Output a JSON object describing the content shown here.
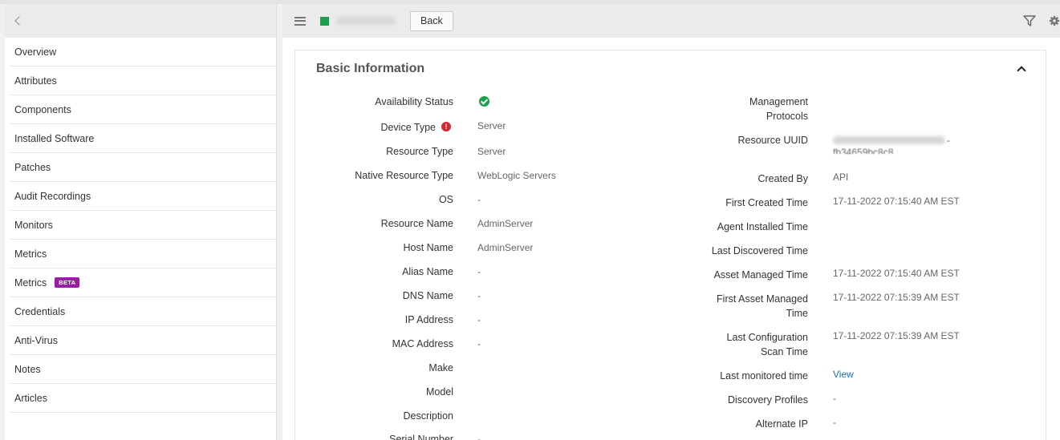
{
  "sidebar": {
    "items": [
      {
        "label": "Overview"
      },
      {
        "label": "Attributes"
      },
      {
        "label": "Components"
      },
      {
        "label": "Installed Software"
      },
      {
        "label": "Patches"
      },
      {
        "label": "Audit Recordings"
      },
      {
        "label": "Monitors"
      },
      {
        "label": "Metrics"
      },
      {
        "label": "Metrics",
        "badge": "BETA"
      },
      {
        "label": "Credentials"
      },
      {
        "label": "Anti-Virus"
      },
      {
        "label": "Notes"
      },
      {
        "label": "Articles"
      }
    ]
  },
  "toolbar": {
    "back_label": "Back",
    "status_color": "#1aa04a"
  },
  "panel": {
    "title": "Basic Information",
    "left": [
      {
        "label": "Availability Status",
        "value": "",
        "icon": "check-circle-icon"
      },
      {
        "label": "Device Type",
        "value": "Server",
        "icon": "warning-icon"
      },
      {
        "label": "Resource Type",
        "value": "Server"
      },
      {
        "label": "Native Resource Type",
        "value": "WebLogic Servers"
      },
      {
        "label": "OS",
        "value": "-"
      },
      {
        "label": "Resource Name",
        "value": "AdminServer"
      },
      {
        "label": "Host Name",
        "value": "AdminServer"
      },
      {
        "label": "Alias Name",
        "value": "-"
      },
      {
        "label": "DNS Name",
        "value": "-"
      },
      {
        "label": "IP Address",
        "value": "-"
      },
      {
        "label": "MAC Address",
        "value": "-"
      },
      {
        "label": "Make",
        "value": ""
      },
      {
        "label": "Model",
        "value": ""
      },
      {
        "label": "Description",
        "value": ""
      },
      {
        "label": "Serial Number",
        "value": "-"
      }
    ],
    "right": [
      {
        "label_line1": "Management",
        "label_line2": "Protocols",
        "value": ""
      },
      {
        "label_line1": "Resource UUID",
        "label_line2": "",
        "value": "-",
        "value_line2": "fb34659bc8c8"
      },
      {
        "label_line1": "Created By",
        "label_line2": "",
        "value": "API"
      },
      {
        "label_line1": "First Created Time",
        "label_line2": "",
        "value": "17-11-2022 07:15:40 AM EST"
      },
      {
        "label_line1": "Agent Installed Time",
        "label_line2": "",
        "value": ""
      },
      {
        "label_line1": "Last Discovered Time",
        "label_line2": "",
        "value": ""
      },
      {
        "label_line1": "Asset Managed Time",
        "label_line2": "",
        "value": "17-11-2022 07:15:40 AM EST"
      },
      {
        "label_line1": "First Asset Managed",
        "label_line2": "Time",
        "value": "17-11-2022 07:15:39 AM EST"
      },
      {
        "label_line1": "Last Configuration",
        "label_line2": "Scan Time",
        "value": "17-11-2022 07:15:39 AM EST"
      },
      {
        "label_line1": "Last monitored time",
        "label_line2": "",
        "value": "View"
      },
      {
        "label_line1": "Discovery Profiles",
        "label_line2": "",
        "value": "-"
      },
      {
        "label_line1": "Alternate IP",
        "label_line2": "",
        "value": "-"
      }
    ]
  }
}
